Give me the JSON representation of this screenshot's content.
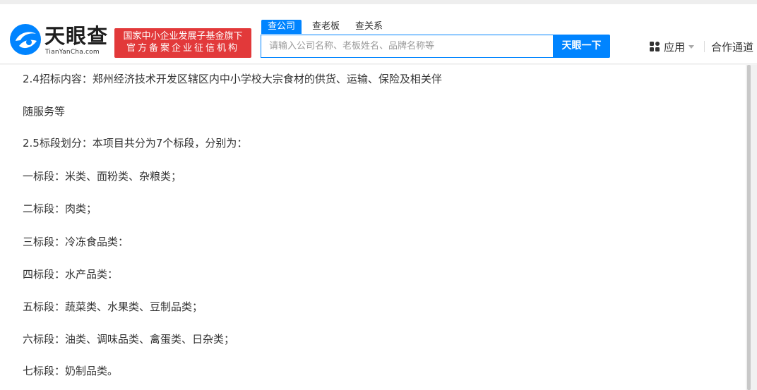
{
  "header": {
    "logo": {
      "name": "天眼查",
      "domain": "TianYanCha.com",
      "icon": "tianyancha-logo-icon",
      "brand_color": "#0084ff"
    },
    "slogan": {
      "line1": "国家中小企业发展子基金旗下",
      "line2": "官方备案企业征信机构",
      "bg_color": "#e2393a"
    },
    "search": {
      "tabs": [
        {
          "label": "查公司",
          "active": true
        },
        {
          "label": "查老板",
          "active": false
        },
        {
          "label": "查关系",
          "active": false
        }
      ],
      "placeholder": "请输入公司名称、老板姓名、品牌名称等",
      "button_label": "天眼一下"
    },
    "nav": {
      "apps_label": "应用",
      "apps_icon": "apps-grid-icon",
      "partner_label": "合作通道"
    }
  },
  "content": {
    "paragraphs": [
      "2.4招标内容：郑州经济技术开发区辖区内中小学校大宗食材的供货、运输、保险及相关伴",
      "随服务等",
      "2.5标段划分：本项目共分为7个标段，分别为：",
      "一标段：米类、面粉类、杂粮类；",
      "二标段：肉类；",
      "三标段：冷冻食品类：",
      "四标段：水产品类：",
      "五标段：蔬菜类、水果类、豆制品类；",
      "六标段：油类、调味品类、禽蛋类、日杂类；",
      "七标段：奶制品类。"
    ]
  }
}
